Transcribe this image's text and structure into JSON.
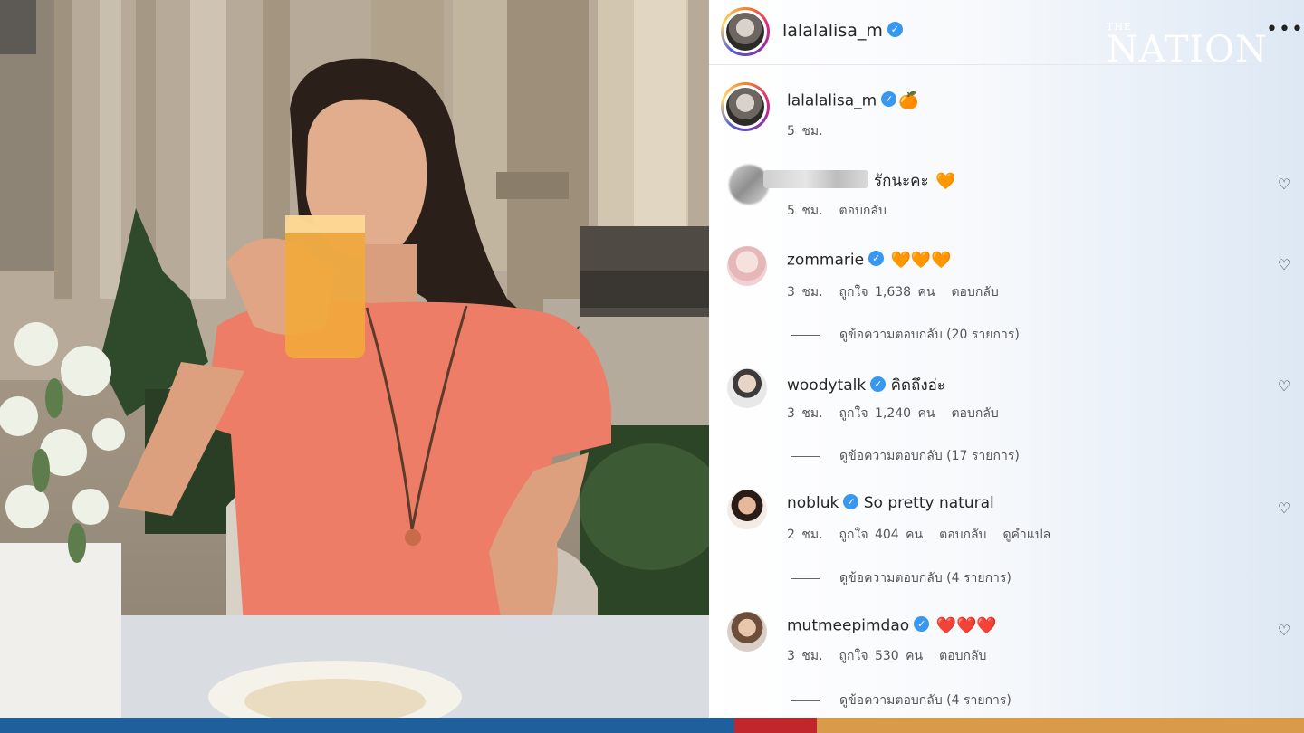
{
  "post": {
    "author": "lalalalisa_m",
    "caption_emoji": "🍊",
    "time": "5 ชม."
  },
  "watermark": {
    "small": "THE",
    "big": "NATION"
  },
  "comments": [
    {
      "user": "",
      "verified": false,
      "text": "รักนะคะ",
      "emoji": "🧡",
      "time": "5 ชม.",
      "reply": "ตอบกลับ"
    },
    {
      "user": "zommarie",
      "verified": true,
      "text": "",
      "emoji": "🧡🧡🧡",
      "time": "3 ชม.",
      "likes": "ถูกใจ 1,638 คน",
      "reply": "ตอบกลับ",
      "view_replies": "ดูข้อความตอบกลับ (20 รายการ)"
    },
    {
      "user": "woodytalk",
      "verified": true,
      "text": "คิดถึงอ่ะ",
      "emoji": "",
      "time": "3 ชม.",
      "likes": "ถูกใจ 1,240 คน",
      "reply": "ตอบกลับ",
      "view_replies": "ดูข้อความตอบกลับ (17 รายการ)"
    },
    {
      "user": "nobluk",
      "verified": true,
      "text": "So pretty natural",
      "emoji": "",
      "time": "2 ชม.",
      "likes": "ถูกใจ 404 คน",
      "reply": "ตอบกลับ",
      "translate": "ดูคำแปล",
      "view_replies": "ดูข้อความตอบกลับ (4 รายการ)"
    },
    {
      "user": "mutmeepimdao",
      "verified": true,
      "text": "",
      "emoji": "❤️❤️❤️",
      "time": "3 ชม.",
      "likes": "ถูกใจ 530 คน",
      "reply": "ตอบกลับ",
      "view_replies": "ดูข้อความตอบกลับ (4 รายการ)"
    }
  ],
  "icons": {
    "verified": "verified-badge-icon",
    "like": "heart-outline-icon",
    "more": "more-options-icon"
  },
  "colors": {
    "verified_blue": "#3897f0",
    "bar_blue": "#1f5f9c",
    "bar_red": "#c0262b",
    "bar_gold": "#d99a4a"
  }
}
